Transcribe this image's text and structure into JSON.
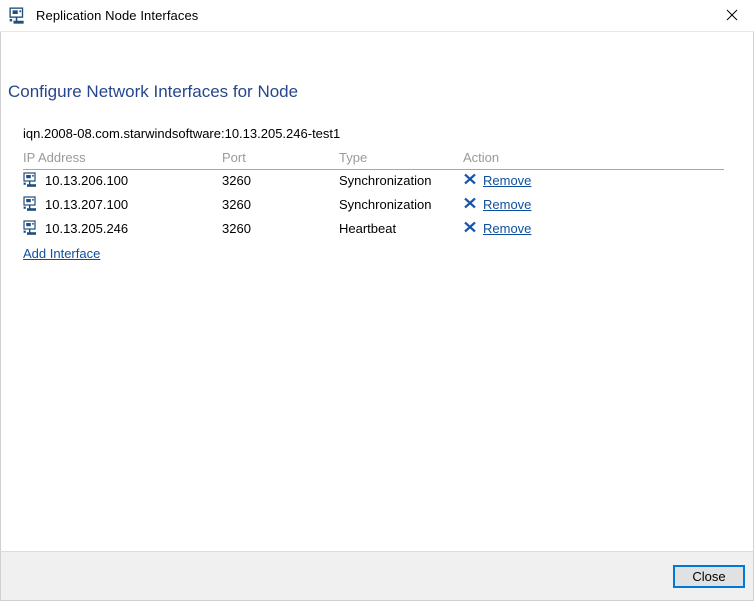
{
  "window": {
    "title": "Replication Node Interfaces",
    "title_icon": "network-interface-icon",
    "close_icon": "close-icon"
  },
  "page": {
    "heading": "Configure Network Interfaces for Node",
    "target_iqn": "iqn.2008-08.com.starwindsoftware:10.13.205.246-test1"
  },
  "table": {
    "columns": [
      "IP Address",
      "Port",
      "Type",
      "Action"
    ],
    "rows": [
      {
        "icon": "network-interface-icon",
        "ip_address": "10.13.206.100",
        "port": "3260",
        "type": "Synchronization",
        "action_icon": "x-icon",
        "action_label": "Remove"
      },
      {
        "icon": "network-interface-icon",
        "ip_address": "10.13.207.100",
        "port": "3260",
        "type": "Synchronization",
        "action_icon": "x-icon",
        "action_label": "Remove"
      },
      {
        "icon": "network-interface-icon",
        "ip_address": "10.13.205.246",
        "port": "3260",
        "type": "Heartbeat",
        "action_icon": "x-icon",
        "action_label": "Remove"
      }
    ],
    "add_link": "Add Interface"
  },
  "footer": {
    "close_label": "Close"
  },
  "colors": {
    "heading_blue": "#26478d",
    "link_blue": "#0d4f9e",
    "icon_blue": "#1f4e79",
    "focus_blue": "#0078d7",
    "header_gray": "#9a9a9a",
    "footer_bg": "#f0f0f0"
  }
}
